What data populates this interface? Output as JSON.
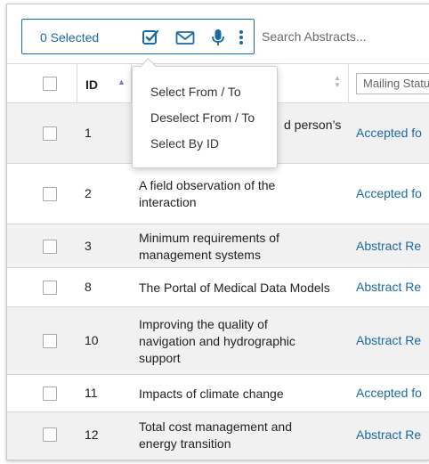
{
  "toolbar": {
    "selected_label": "0 Selected",
    "icons": [
      "checkbox-check-icon",
      "mail-icon",
      "microphone-icon",
      "more-vertical-icon"
    ]
  },
  "search": {
    "placeholder": "Search Abstracts..."
  },
  "table": {
    "headers": {
      "id": "ID",
      "mailing_status_placeholder": "Mailing Status"
    },
    "rows": [
      {
        "id": "1",
        "title_visible": "d person’s",
        "status": "Accepted fo"
      },
      {
        "id": "2",
        "title_line1": "A field observation of the",
        "title_line2": "interaction",
        "status": "Accepted fo"
      },
      {
        "id": "3",
        "title_line1": "Minimum requirements of",
        "title_line2": "management systems",
        "status": "Abstract Re"
      },
      {
        "id": "8",
        "title_line1": "The Portal of Medical Data Models",
        "status": "Abstract Re"
      },
      {
        "id": "10",
        "title_line1": "Improving the quality of",
        "title_line2": "navigation and hydrographic",
        "title_line3": "support",
        "status": "Abstract Re"
      },
      {
        "id": "11",
        "title_line1": "Impacts of climate change",
        "status": "Accepted fo"
      },
      {
        "id": "12",
        "title_line1": "Total cost management and",
        "title_line2": "energy transition",
        "status": "Abstract Re"
      }
    ]
  },
  "menu": {
    "items": [
      "Select From / To",
      "Deselect From / To",
      "Select By ID"
    ]
  },
  "colors": {
    "accent": "#1b6aa3",
    "row_alt": "#f1f1f1",
    "border": "#dcdcdc"
  }
}
